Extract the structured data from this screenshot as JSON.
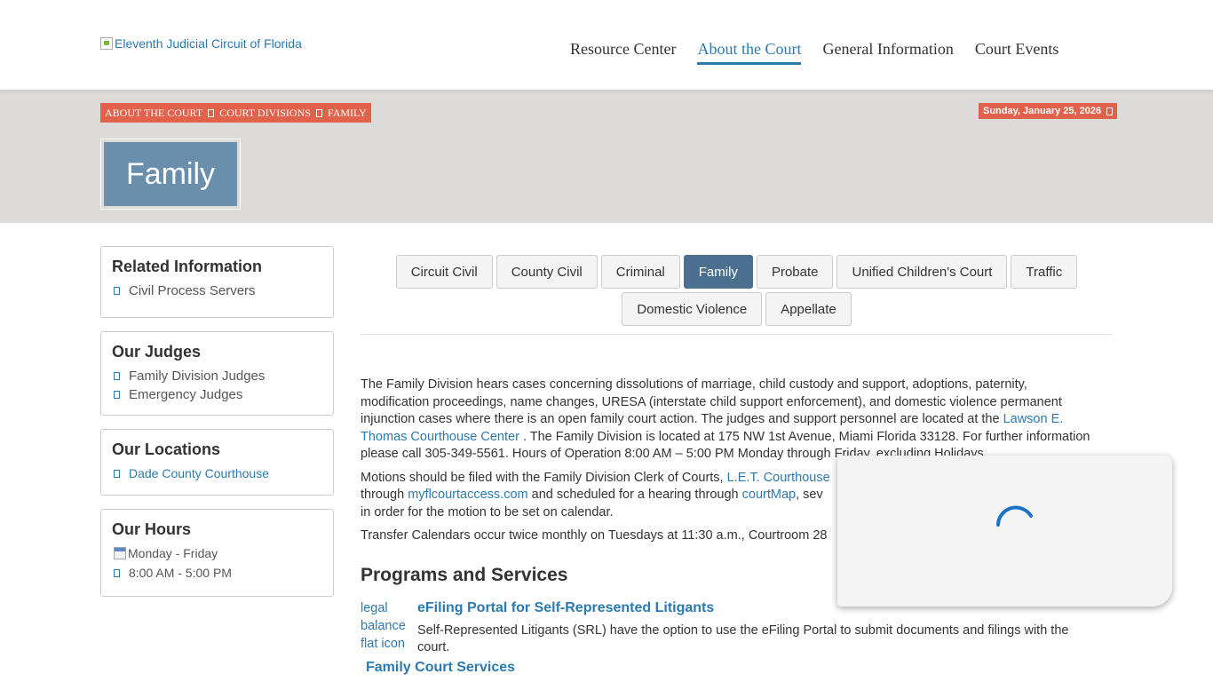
{
  "header": {
    "logo_alt": "Eleventh Judicial Circuit of Florida",
    "nav": [
      {
        "label": "Resource Center",
        "active": false
      },
      {
        "label": "About the Court",
        "active": true
      },
      {
        "label": "General Information",
        "active": false
      },
      {
        "label": "Court Events",
        "active": false
      }
    ]
  },
  "banner": {
    "breadcrumb": [
      "ABOUT THE COURT",
      "COURT DIVISIONS",
      "FAMILY"
    ],
    "date": "Sunday, January 25, 2026",
    "page_title": "Family"
  },
  "sidebar": {
    "related": {
      "title": "Related Information",
      "items": [
        "Civil Process Servers"
      ]
    },
    "judges": {
      "title": "Our Judges",
      "items": [
        "Family Division Judges",
        "Emergency Judges"
      ]
    },
    "locations": {
      "title": "Our Locations",
      "items": [
        "Dade County Courthouse"
      ]
    },
    "hours": {
      "title": "Our Hours",
      "days": "Monday - Friday",
      "time": "8:00 AM - 5:00 PM"
    }
  },
  "tabs": {
    "row1": [
      "Circuit Civil",
      "County Civil",
      "Criminal",
      "Family",
      "Probate",
      "Unified Children's Court",
      "Traffic"
    ],
    "row2": [
      "Domestic Violence",
      "Appellate"
    ],
    "active": "Family"
  },
  "content": {
    "p1_a": "The Family Division hears cases concerning dissolutions of marriage, child custody and support, adoptions, paternity, modification proceedings, name changes, URESA (interstate child support enforcement), and domestic violence permanent injunction cases where there is an open family court action. The judges and support personnel are located at the",
    "p1_link": "Lawson E. Thomas Courthouse Center",
    "p1_b": ". The Family Division is located at 175 NW 1st Avenue, Miami Florida 33128. For further information please call 305-349-5561. Hours of Operation 8:00 AM – 5:00 PM Monday through Friday, excluding Holidays.",
    "p2_a": "Motions should be filed with the Family Division Clerk of Courts,",
    "p2_link1": "L.E.T. Courthouse",
    "p2_b": "through",
    "p2_link2": "myflcourtaccess.com",
    "p2_c": "and scheduled for a hearing through",
    "p2_link3": "courtMap",
    "p2_d": ", sev",
    "p2_e": "in order for the motion to be set on calendar.",
    "p3": "Transfer Calendars occur twice monthly on Tuesdays at 11:30 a.m., Courtroom 28",
    "programs_heading": "Programs and Services",
    "program1": {
      "img_alt": "legal balance flat icon",
      "title": "eFiling Portal for Self-Represented Litigants",
      "text": "Self-Represented Litigants (SRL) have the option to use the eFiling Portal to submit documents and filings with the court."
    },
    "program2_title": "Family Court Services"
  },
  "colors": {
    "accent": "#2a7ab0",
    "badge": "#e2614a",
    "title_box": "#6a8fad",
    "tab_active": "#4a6f8f",
    "banner_bg": "#dddbd9"
  }
}
